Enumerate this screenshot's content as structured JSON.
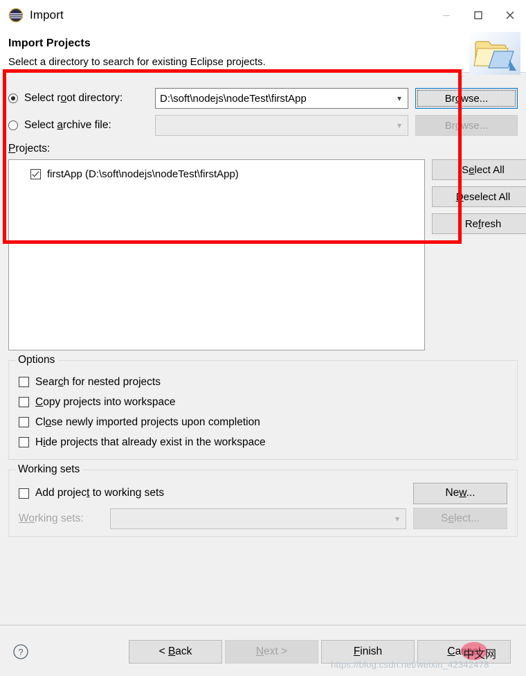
{
  "window": {
    "title": "Import",
    "app_icon": "eclipse-logo-icon",
    "minimize_label": "—",
    "maximize_label": "□",
    "close_label": "✕"
  },
  "header": {
    "title": "Import Projects",
    "description": "Select a directory to search for existing Eclipse projects.",
    "banner_icon": "folder-import-icon"
  },
  "source": {
    "root_directory": {
      "label_pre": "Select r",
      "label_mnemonic": "o",
      "label_post": "ot directory:",
      "selected": true,
      "value": "D:\\soft\\nodejs\\nodeTest\\firstApp",
      "browse_pre": "Br",
      "browse_mnemonic": "o",
      "browse_post": "wse...",
      "browse_enabled": true
    },
    "archive_file": {
      "label_pre": "Select ",
      "label_mnemonic": "a",
      "label_post": "rchive file:",
      "selected": false,
      "value": "",
      "browse_pre": "Br",
      "browse_mnemonic": "o",
      "browse_post": "wse...",
      "browse_enabled": false
    }
  },
  "projects": {
    "label_mnemonic": "P",
    "label_post": "rojects:",
    "items": [
      {
        "label": "firstApp (D:\\soft\\nodejs\\nodeTest\\firstApp)",
        "checked": true
      }
    ],
    "buttons": [
      {
        "pre": "S",
        "mnemonic": "e",
        "post": "lect All",
        "enabled": true
      },
      {
        "pre": "",
        "mnemonic": "D",
        "post": "eselect All",
        "enabled": true
      },
      {
        "pre": "Re",
        "mnemonic": "f",
        "post": "resh",
        "enabled": true
      }
    ]
  },
  "options": {
    "title": "Options",
    "items": [
      {
        "pre": "Sear",
        "mnemonic": "c",
        "post": "h for nested projects",
        "checked": false
      },
      {
        "pre": "",
        "mnemonic": "C",
        "post": "opy projects into workspace",
        "checked": false
      },
      {
        "pre": "Cl",
        "mnemonic": "o",
        "post": "se newly imported projects upon completion",
        "checked": false
      },
      {
        "pre": "H",
        "mnemonic": "i",
        "post": "de projects that already exist in the workspace",
        "checked": false
      }
    ]
  },
  "working_sets": {
    "title": "Working sets",
    "add_checkbox": {
      "pre": "Add projec",
      "mnemonic": "t",
      "post": " to working sets",
      "checked": false
    },
    "new_button": {
      "pre": "Ne",
      "mnemonic": "w",
      "post": "...",
      "enabled": true
    },
    "combo_label_pre": "W",
    "combo_label_mnemonic": "o",
    "combo_label_post": "rking sets:",
    "combo_value": "",
    "combo_enabled": false,
    "select_button": {
      "pre": "S",
      "mnemonic": "e",
      "post": "lect...",
      "enabled": false
    }
  },
  "footer": {
    "help_icon": "help-question-icon",
    "buttons": [
      {
        "pre": "< ",
        "mnemonic": "B",
        "post": "ack",
        "enabled": true
      },
      {
        "pre": "",
        "mnemonic": "N",
        "post": "ext >",
        "enabled": false
      },
      {
        "pre": "",
        "mnemonic": "F",
        "post": "inish",
        "enabled": true
      },
      {
        "pre": "",
        "mnemonic": "C",
        "post": "ancel",
        "enabled": true
      }
    ]
  },
  "annotation": {
    "color": "#fb0000",
    "shape": "rectangle"
  },
  "watermark": {
    "url": "https://blog.csdn.net/weixin_42342478",
    "badge_text": "中文网"
  }
}
